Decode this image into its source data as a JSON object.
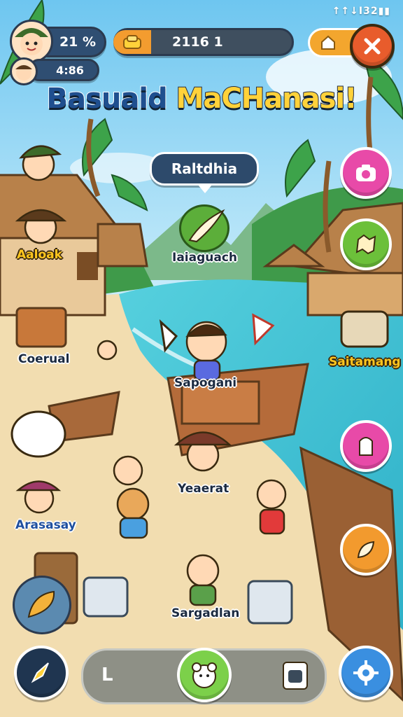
{
  "status_bar": {
    "text": "↑↑↓I32▮▮"
  },
  "player": {
    "stat_primary": "21 %",
    "stat_secondary": "4:86"
  },
  "currency": {
    "value": "2116 1"
  },
  "title": {
    "part1": "Basuaid ",
    "part2": "MaCHanasi!"
  },
  "speech_bubble": {
    "text": "Raltdhia"
  },
  "labels": {
    "aaloak": "Aaloak",
    "iaiaguach": "Iaiaguach",
    "coerual": "Coerual",
    "sapogani": "Sapogani",
    "saitamang": "Saitamang",
    "yeaerat": "Yeaerat",
    "arasasay": "Arasasay",
    "sargadlan": "Sargadlan"
  },
  "bottom_nav": {
    "left_label": "L"
  },
  "colors": {
    "sky": "#8fd3f4",
    "sea": "#3fc3d6",
    "sand": "#f2ddb0",
    "accent_orange": "#f2a23a",
    "close_red": "#e85c2c",
    "pink_button": "#e84aa8",
    "green_button": "#6cc03a",
    "blue_button": "#3a8fe0"
  }
}
